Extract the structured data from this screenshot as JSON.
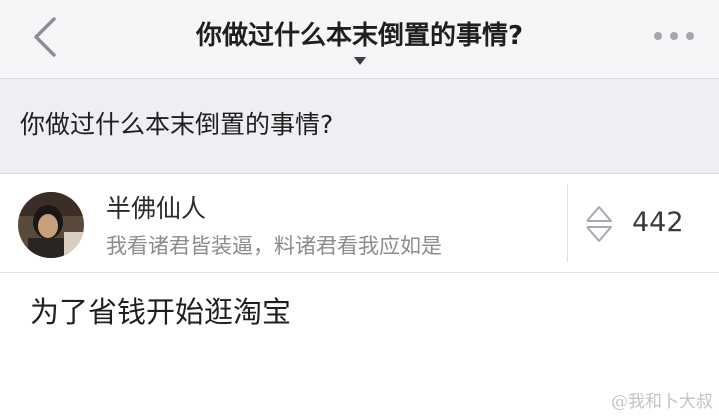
{
  "nav": {
    "title": "你做过什么本末倒置的事情?",
    "back_icon": "chevron-left-icon",
    "more_icon": "more-horizontal-icon",
    "caret_icon": "caret-down-icon"
  },
  "question": {
    "text": "你做过什么本末倒置的事情?"
  },
  "answer": {
    "author_name": "半佛仙人",
    "author_bio": "我看诸君皆装逼，料诸君看我应如是",
    "vote_count": "442",
    "vote_icon": "vote-up-down-icon",
    "body": "为了省钱开始逛淘宝"
  },
  "watermark": "@我和卜大叔"
}
